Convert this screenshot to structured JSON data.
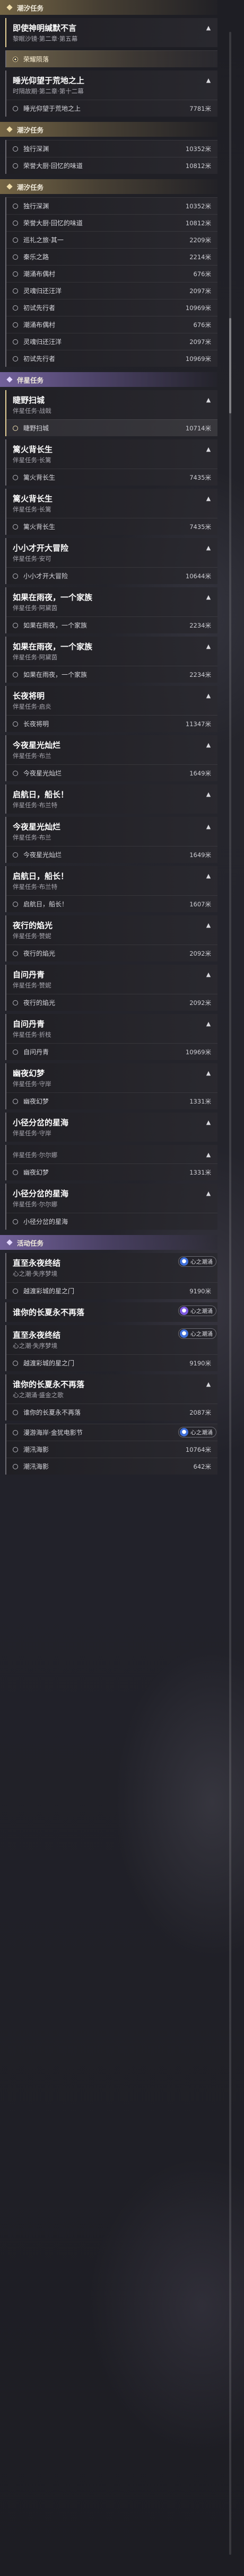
{
  "groups": [
    {
      "label": "潮汐任务",
      "kind": "main",
      "cards": [
        {
          "title": "即使神明缄默不言",
          "sub": "黎眠沙镜·第二章·第五幕",
          "active": true,
          "rows": []
        },
        {
          "title": "",
          "sub": "",
          "active": false,
          "rows": [
            {
              "name": "荣耀陨落",
              "dist": "",
              "state": "sel"
            }
          ]
        },
        {
          "title": "睡光仰望于荒地之上",
          "sub": "时隔故期·第二章·第十二幕",
          "active": false,
          "rows": [
            {
              "name": "睡光仰望于荒地之上",
              "dist": "7781米",
              "state": ""
            }
          ]
        }
      ]
    },
    {
      "label": "潮汐任务",
      "kind": "main",
      "cards": [
        {
          "title": "",
          "sub": "",
          "active": false,
          "rows": [
            {
              "name": "独行深渊",
              "dist": "10352米",
              "state": ""
            },
            {
              "name": "荣誉大厨·回忆的味道",
              "dist": "10812米",
              "state": ""
            }
          ]
        }
      ]
    },
    {
      "label": "潮汐任务",
      "kind": "main",
      "cards": [
        {
          "title": "",
          "sub": "",
          "active": false,
          "rows": [
            {
              "name": "独行深渊",
              "dist": "10352米",
              "state": ""
            },
            {
              "name": "荣誉大厨·回忆的味道",
              "dist": "10812米",
              "state": ""
            },
            {
              "name": "巡礼之旅·其一",
              "dist": "2209米",
              "state": ""
            },
            {
              "name": "秦乐之路",
              "dist": "2214米",
              "state": ""
            },
            {
              "name": "潮涌布偶村",
              "dist": "676米",
              "state": ""
            },
            {
              "name": "灵魂归还汪洋",
              "dist": "2097米",
              "state": ""
            },
            {
              "name": "初试先行者",
              "dist": "10969米",
              "state": ""
            },
            {
              "name": "潮涌布偶村",
              "dist": "676米",
              "state": ""
            },
            {
              "name": "灵魂归还汪洋",
              "dist": "2097米",
              "state": ""
            },
            {
              "name": "初试先行者",
              "dist": "10969米",
              "state": ""
            }
          ]
        }
      ]
    },
    {
      "label": "伴星任务",
      "kind": "side",
      "cards": [
        {
          "title": "睫野扫城",
          "sub": "伴星任务·战戟",
          "active": true,
          "rows": [
            {
              "name": "睫野扫城",
              "dist": "10714米",
              "state": "trk"
            }
          ]
        },
        {
          "title": "篱火背长生",
          "sub": "伴星任务·长篱",
          "active": false,
          "rows": [
            {
              "name": "篱火背长生",
              "dist": "7435米",
              "state": ""
            }
          ]
        },
        {
          "title": "篱火背长生",
          "sub": "伴星任务·长篱",
          "active": false,
          "rows": [
            {
              "name": "篱火背长生",
              "dist": "7435米",
              "state": ""
            }
          ]
        },
        {
          "title": "小小才开大冒险",
          "sub": "伴星任务·安可",
          "active": false,
          "rows": [
            {
              "name": "小小才开大冒险",
              "dist": "10644米",
              "state": ""
            }
          ]
        },
        {
          "title": "如果在雨夜，一个家族",
          "sub": "伴星任务·阿黛茵",
          "active": false,
          "rows": [
            {
              "name": "如果在雨夜，一个家族",
              "dist": "2234米",
              "state": ""
            }
          ]
        },
        {
          "title": "如果在雨夜，一个家族",
          "sub": "伴星任务·阿黛茵",
          "active": false,
          "rows": [
            {
              "name": "如果在雨夜，一个家族",
              "dist": "2234米",
              "state": ""
            }
          ]
        },
        {
          "title": "长夜将明",
          "sub": "伴星任务·启炎",
          "active": false,
          "rows": [
            {
              "name": "长夜将明",
              "dist": "11347米",
              "state": ""
            }
          ]
        },
        {
          "title": "今夜星光灿烂",
          "sub": "伴星任务·布兰",
          "active": false,
          "rows": [
            {
              "name": "今夜星光灿烂",
              "dist": "1649米",
              "state": ""
            }
          ]
        },
        {
          "title": "启航日，船长！",
          "sub": "伴星任务·布兰特",
          "active": false,
          "rows": []
        },
        {
          "title": "今夜星光灿烂",
          "sub": "伴星任务·布兰",
          "active": false,
          "rows": [
            {
              "name": "今夜星光灿烂",
              "dist": "1649米",
              "state": ""
            }
          ]
        },
        {
          "title": "启航日，船长！",
          "sub": "伴星任务·布兰特",
          "active": false,
          "rows": [
            {
              "name": "启航日，船长！",
              "dist": "1607米",
              "state": ""
            }
          ]
        },
        {
          "title": "夜行的焰光",
          "sub": "伴星任务·赞妮",
          "active": false,
          "rows": [
            {
              "name": "夜行的焰光",
              "dist": "2092米",
              "state": ""
            }
          ]
        },
        {
          "title": "自问丹青",
          "sub": "伴星任务·赞妮",
          "active": false,
          "rows": [
            {
              "name": "夜行的焰光",
              "dist": "2092米",
              "state": ""
            }
          ]
        },
        {
          "title": "自问丹青",
          "sub": "伴星任务·折枝",
          "active": false,
          "rows": [
            {
              "name": "自问丹青",
              "dist": "10969米",
              "state": ""
            }
          ]
        },
        {
          "title": "幽夜幻梦",
          "sub": "伴星任务·守岸",
          "active": false,
          "rows": [
            {
              "name": "幽夜幻梦",
              "dist": "1331米",
              "state": ""
            }
          ]
        },
        {
          "title": "小径分岔的星海",
          "sub": "伴星任务·守岸",
          "active": false,
          "rows": []
        },
        {
          "title": "",
          "sub": "伴星任务·尔尔娜",
          "active": false,
          "rows": [
            {
              "name": "幽夜幻梦",
              "dist": "1331米",
              "state": ""
            }
          ]
        },
        {
          "title": "小径分岔的星海",
          "sub": "伴星任务·尔尔娜",
          "active": false,
          "rows": [
            {
              "name": "小径分岔的星海",
              "dist": "",
              "state": ""
            }
          ]
        }
      ]
    },
    {
      "label": "活动任务",
      "kind": "side",
      "cards": [
        {
          "title": "直至永夜终结",
          "sub": "心之潮·失序梦境",
          "active": false,
          "tag": "心之潮涌",
          "rows": [
            {
              "name": "越渡彩城的星之门",
              "dist": "9190米",
              "state": ""
            }
          ]
        },
        {
          "title": "谁你的长夏永不再落",
          "sub": "",
          "active": false,
          "tag": "心之潮涌",
          "rows": []
        },
        {
          "title": "直至永夜终结",
          "sub": "心之潮·失序梦境",
          "active": false,
          "tag": "心之潮涌",
          "rows": [
            {
              "name": "越渡彩城的星之门",
              "dist": "9190米",
              "state": ""
            }
          ]
        },
        {
          "title": "谁你的长夏永不再落",
          "sub": "心之潮涌·盛金之歌",
          "active": false,
          "rows": [
            {
              "name": "谁你的长夏永不再落",
              "dist": "2087米",
              "state": ""
            }
          ]
        },
        {
          "title": "",
          "sub": "",
          "active": false,
          "tag": "心之潮涌",
          "rows": [
            {
              "name": "漫游海岸·金犹电影节",
              "dist": "9190米",
              "state": ""
            },
            {
              "name": "潮汛海影",
              "dist": "10764米",
              "state": ""
            },
            {
              "name": "潮汛海影",
              "dist": "642米",
              "state": ""
            }
          ]
        }
      ]
    }
  ],
  "icons": {
    "group": "diamond-icon",
    "chevron": "chevron-up-icon",
    "track": "circle-radio-icon",
    "tag": "globe-badge-icon"
  }
}
